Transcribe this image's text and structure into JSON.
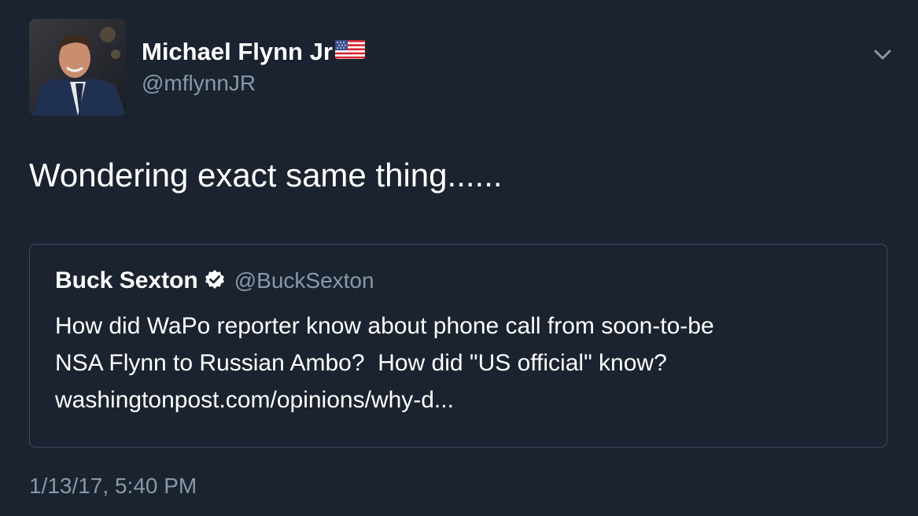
{
  "author": {
    "display_name": "Michael Flynn Jr",
    "flag_icon": "us-flag-icon",
    "handle": "@mflynnJR",
    "avatar_icon": "profile-photo"
  },
  "menu": {
    "icon": "chevron-down-icon"
  },
  "tweet": {
    "text": "Wondering exact same thing......",
    "timestamp": "1/13/17, 5:40 PM"
  },
  "quoted_tweet": {
    "display_name": "Buck Sexton",
    "verified_icon": "verified-badge-icon",
    "handle": "@BuckSexton",
    "lines": [
      "How did WaPo reporter know about phone call from soon-to-be",
      "NSA Flynn to Russian Ambo?  How did \"US official\" know?",
      "washingtonpost.com/opinions/why-d..."
    ]
  },
  "colors": {
    "background": "#1b2330",
    "secondary_text": "#8899a6",
    "border": "#3d4b5c"
  }
}
